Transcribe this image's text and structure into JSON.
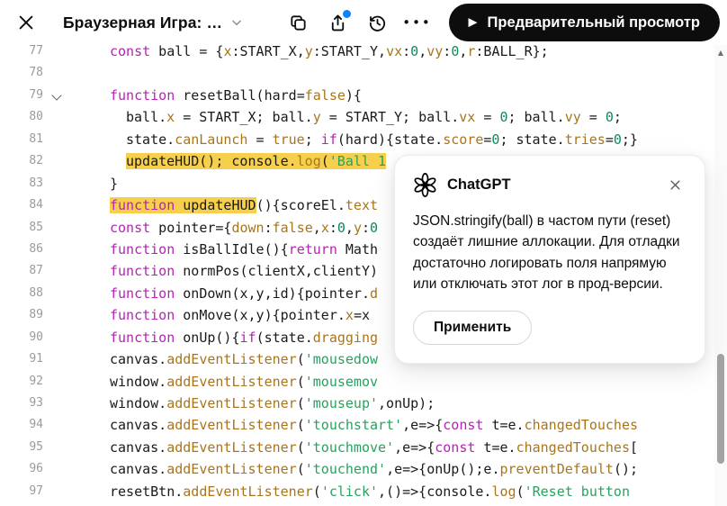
{
  "header": {
    "title": "Браузерная Игра: …",
    "preview_label": "Предварительный просмотр"
  },
  "icons": {
    "more": "•••",
    "play": "▶",
    "scroll_up": "▲"
  },
  "colors": {
    "accent_blue": "#0b84ff",
    "highlight_yellow": "#f6d04d",
    "button_black": "#0d0d0d",
    "keyword": "#b424b4",
    "property": "#a8751c",
    "string": "#27a35e",
    "number": "#0e8a57"
  },
  "popup": {
    "title": "ChatGPT",
    "body": "JSON.stringify(ball) в частом пути (reset) создаёт лишние аллокации. Для отладки достаточно логировать поля напрямую или отключать этот лог в прод-версии.",
    "apply_label": "Применить"
  },
  "editor": {
    "lines": [
      {
        "num": "77",
        "indent": 0,
        "tokens": [
          [
            "k",
            "const"
          ],
          [
            "d",
            " ball = {"
          ],
          [
            "p",
            "x"
          ],
          [
            "d",
            ":START_X,"
          ],
          [
            "p",
            "y"
          ],
          [
            "d",
            ":START_Y,"
          ],
          [
            "p",
            "vx"
          ],
          [
            "d",
            ":"
          ],
          [
            "n",
            "0"
          ],
          [
            "d",
            ","
          ],
          [
            "p",
            "vy"
          ],
          [
            "d",
            ":"
          ],
          [
            "n",
            "0"
          ],
          [
            "d",
            ","
          ],
          [
            "p",
            "r"
          ],
          [
            "d",
            ":BALL_R};"
          ]
        ]
      },
      {
        "num": "78",
        "indent": 0,
        "tokens": []
      },
      {
        "num": "79",
        "indent": 0,
        "fold": true,
        "tokens": [
          [
            "k",
            "function"
          ],
          [
            "d",
            " resetBall(hard="
          ],
          [
            "p",
            "false"
          ],
          [
            "d",
            "){"
          ]
        ]
      },
      {
        "num": "80",
        "indent": 1,
        "tokens": [
          [
            "d",
            "ball."
          ],
          [
            "p",
            "x"
          ],
          [
            "d",
            " = START_X; ball."
          ],
          [
            "p",
            "y"
          ],
          [
            "d",
            " = START_Y; ball."
          ],
          [
            "p",
            "vx"
          ],
          [
            "d",
            " = "
          ],
          [
            "n",
            "0"
          ],
          [
            "d",
            "; ball."
          ],
          [
            "p",
            "vy"
          ],
          [
            "d",
            " = "
          ],
          [
            "n",
            "0"
          ],
          [
            "d",
            ";"
          ]
        ]
      },
      {
        "num": "81",
        "indent": 1,
        "tokens": [
          [
            "d",
            "state."
          ],
          [
            "p",
            "canLaunch"
          ],
          [
            "d",
            " = "
          ],
          [
            "p",
            "true"
          ],
          [
            "d",
            "; "
          ],
          [
            "k",
            "if"
          ],
          [
            "d",
            "(hard){state."
          ],
          [
            "p",
            "score"
          ],
          [
            "d",
            "="
          ],
          [
            "n",
            "0"
          ],
          [
            "d",
            "; state."
          ],
          [
            "p",
            "tries"
          ],
          [
            "d",
            "="
          ],
          [
            "n",
            "0"
          ],
          [
            "d",
            ";}"
          ]
        ]
      },
      {
        "num": "82",
        "indent": 1,
        "tokens": [
          [
            "d hl",
            "updateHU"
          ],
          [
            "caret hl",
            ""
          ],
          [
            "d hl",
            "D(); console."
          ],
          [
            "p hl",
            "log"
          ],
          [
            "d hl",
            "("
          ],
          [
            "s hl",
            "'Ball 1"
          ]
        ]
      },
      {
        "num": "83",
        "indent": 0,
        "tokens": [
          [
            "d",
            "}"
          ]
        ]
      },
      {
        "num": "84",
        "indent": 0,
        "tokens": [
          [
            "k hl",
            "function"
          ],
          [
            "d hl",
            " updateHUD"
          ],
          [
            "d",
            "(){scoreEl."
          ],
          [
            "p",
            "text"
          ]
        ]
      },
      {
        "num": "85",
        "indent": 0,
        "tokens": [
          [
            "k",
            "const"
          ],
          [
            "d",
            " pointer={"
          ],
          [
            "p",
            "down"
          ],
          [
            "d",
            ":"
          ],
          [
            "p",
            "false"
          ],
          [
            "d",
            ","
          ],
          [
            "p",
            "x"
          ],
          [
            "d",
            ":"
          ],
          [
            "n",
            "0"
          ],
          [
            "d",
            ","
          ],
          [
            "p",
            "y"
          ],
          [
            "d",
            ":"
          ],
          [
            "n",
            "0"
          ]
        ]
      },
      {
        "num": "86",
        "indent": 0,
        "tokens": [
          [
            "k",
            "function"
          ],
          [
            "d",
            " isBallIdle(){"
          ],
          [
            "k",
            "return"
          ],
          [
            "d",
            " Math"
          ]
        ]
      },
      {
        "num": "87",
        "indent": 0,
        "tokens": [
          [
            "k",
            "function"
          ],
          [
            "d",
            " normPos(clientX,clientY)"
          ]
        ]
      },
      {
        "num": "88",
        "indent": 0,
        "tokens": [
          [
            "k",
            "function"
          ],
          [
            "d",
            " onDown(x,y,id){pointer."
          ],
          [
            "p",
            "d"
          ]
        ]
      },
      {
        "num": "89",
        "indent": 0,
        "tokens": [
          [
            "k",
            "function"
          ],
          [
            "d",
            " onMove(x,y){pointer."
          ],
          [
            "p",
            "x"
          ],
          [
            "d",
            "=x"
          ]
        ]
      },
      {
        "num": "90",
        "indent": 0,
        "tokens": [
          [
            "k",
            "function"
          ],
          [
            "d",
            " onUp(){"
          ],
          [
            "k",
            "if"
          ],
          [
            "d",
            "(state."
          ],
          [
            "p",
            "dragging"
          ]
        ]
      },
      {
        "num": "91",
        "indent": 0,
        "tokens": [
          [
            "d",
            "canvas."
          ],
          [
            "p",
            "addEventListener"
          ],
          [
            "d",
            "("
          ],
          [
            "s",
            "'mousedow"
          ]
        ]
      },
      {
        "num": "92",
        "indent": 0,
        "tokens": [
          [
            "d",
            "window."
          ],
          [
            "p",
            "addEventListener"
          ],
          [
            "d",
            "("
          ],
          [
            "s",
            "'mousemov"
          ]
        ]
      },
      {
        "num": "93",
        "indent": 0,
        "tokens": [
          [
            "d",
            "window."
          ],
          [
            "p",
            "addEventListener"
          ],
          [
            "d",
            "("
          ],
          [
            "s",
            "'mouseup'"
          ],
          [
            "d",
            ",onUp);"
          ]
        ]
      },
      {
        "num": "94",
        "indent": 0,
        "tokens": [
          [
            "d",
            "canvas."
          ],
          [
            "p",
            "addEventListener"
          ],
          [
            "d",
            "("
          ],
          [
            "s",
            "'touchstart'"
          ],
          [
            "d",
            ",e=>{"
          ],
          [
            "k",
            "const"
          ],
          [
            "d",
            " t=e."
          ],
          [
            "p",
            "changedTouches"
          ]
        ]
      },
      {
        "num": "95",
        "indent": 0,
        "tokens": [
          [
            "d",
            "canvas."
          ],
          [
            "p",
            "addEventListener"
          ],
          [
            "d",
            "("
          ],
          [
            "s",
            "'touchmove'"
          ],
          [
            "d",
            ",e=>{"
          ],
          [
            "k",
            "const"
          ],
          [
            "d",
            " t=e."
          ],
          [
            "p",
            "changedTouches"
          ],
          [
            "d",
            "["
          ]
        ]
      },
      {
        "num": "96",
        "indent": 0,
        "tokens": [
          [
            "d",
            "canvas."
          ],
          [
            "p",
            "addEventListener"
          ],
          [
            "d",
            "("
          ],
          [
            "s",
            "'touchend'"
          ],
          [
            "d",
            ",e=>{onUp();e."
          ],
          [
            "p",
            "preventDefault"
          ],
          [
            "d",
            "();"
          ]
        ]
      },
      {
        "num": "97",
        "indent": 0,
        "tokens": [
          [
            "d",
            "resetBtn."
          ],
          [
            "p",
            "addEventListener"
          ],
          [
            "d",
            "("
          ],
          [
            "s",
            "'click'"
          ],
          [
            "d",
            ",()=>{console."
          ],
          [
            "p",
            "log"
          ],
          [
            "d",
            "("
          ],
          [
            "s",
            "'Reset button"
          ]
        ]
      }
    ]
  }
}
